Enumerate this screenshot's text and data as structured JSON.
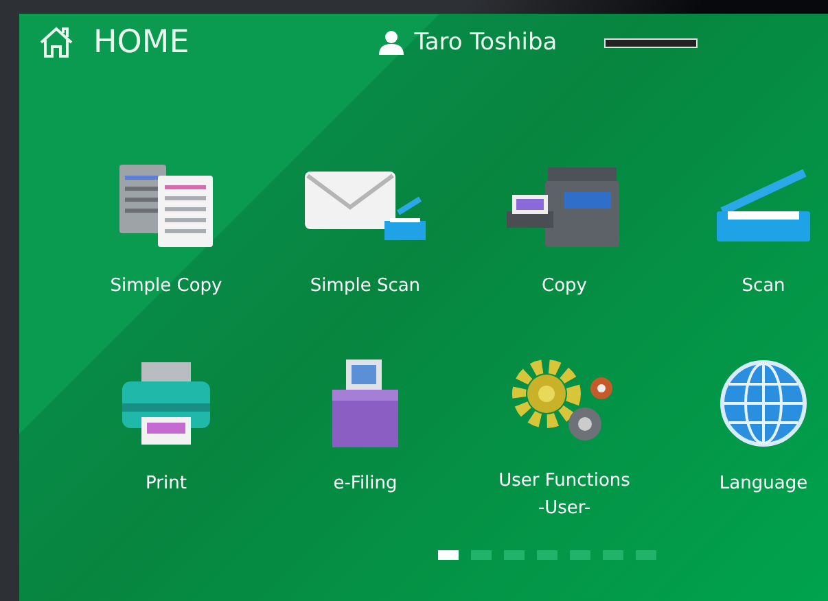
{
  "header": {
    "title": "HOME",
    "user": "Taro Toshiba"
  },
  "tiles": [
    {
      "kind": "simple-copy",
      "label": "Simple Copy"
    },
    {
      "kind": "simple-scan",
      "label": "Simple Scan"
    },
    {
      "kind": "copy",
      "label": "Copy"
    },
    {
      "kind": "scan",
      "label": "Scan"
    },
    {
      "kind": "print",
      "label": "Print"
    },
    {
      "kind": "e-filing",
      "label": "e-Filing"
    },
    {
      "kind": "user-functions",
      "label": "User Functions\n-User-"
    },
    {
      "kind": "language",
      "label": "Language"
    }
  ],
  "pages": [
    {
      "selected": true
    },
    {
      "selected": false
    },
    {
      "selected": false
    },
    {
      "selected": false
    },
    {
      "selected": false
    },
    {
      "selected": false
    },
    {
      "selected": false
    }
  ]
}
